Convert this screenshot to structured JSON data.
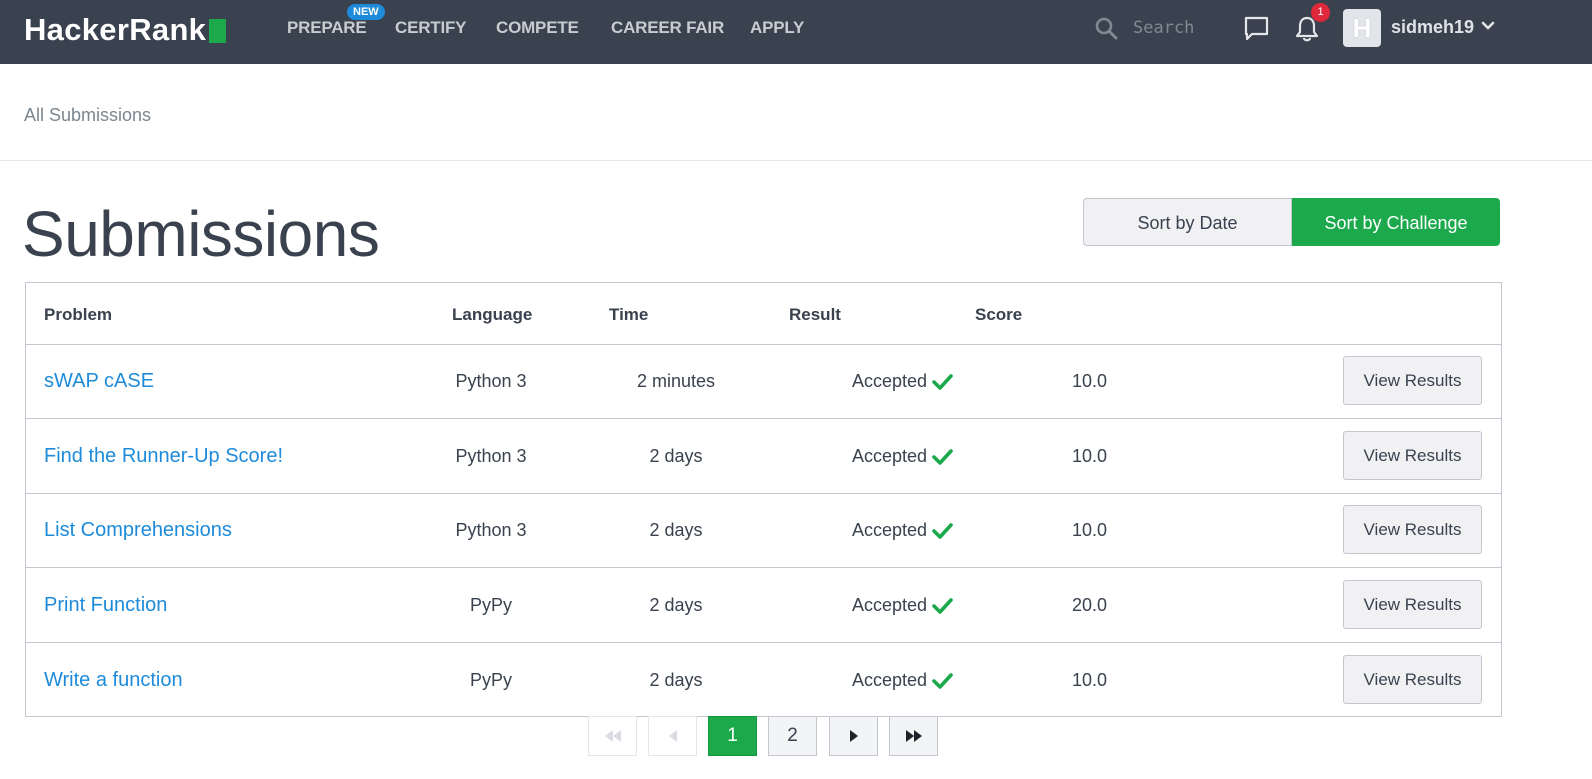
{
  "navbar": {
    "logo_text": "HackerRank",
    "items": [
      {
        "label": "PREPARE"
      },
      {
        "label": "CERTIFY"
      },
      {
        "label": "COMPETE"
      },
      {
        "label": "CAREER FAIR"
      },
      {
        "label": "APPLY"
      }
    ],
    "new_badge": "NEW",
    "search_placeholder": "Search",
    "notification_count": "1",
    "avatar_letter": "H",
    "username": "sidmeh19",
    "icons": [
      "search-icon",
      "chat-icon",
      "bell-icon",
      "chevron-down-icon"
    ]
  },
  "breadcrumb": "All Submissions",
  "page_title": "Submissions",
  "sort": {
    "date_label": "Sort by Date",
    "challenge_label": "Sort by Challenge",
    "active": "challenge"
  },
  "table": {
    "headers": {
      "problem": "Problem",
      "language": "Language",
      "time": "Time",
      "result": "Result",
      "score": "Score"
    },
    "rows": [
      {
        "problem": "sWAP cASE",
        "language": "Python 3",
        "time": "2 minutes",
        "result": "Accepted",
        "score": "10.0",
        "action": "View Results"
      },
      {
        "problem": "Find the Runner-Up Score!",
        "language": "Python 3",
        "time": "2 days",
        "result": "Accepted",
        "score": "10.0",
        "action": "View Results"
      },
      {
        "problem": "List Comprehensions",
        "language": "Python 3",
        "time": "2 days",
        "result": "Accepted",
        "score": "10.0",
        "action": "View Results"
      },
      {
        "problem": "Print Function",
        "language": "PyPy",
        "time": "2 days",
        "result": "Accepted",
        "score": "20.0",
        "action": "View Results"
      },
      {
        "problem": "Write a function",
        "language": "PyPy",
        "time": "2 days",
        "result": "Accepted",
        "score": "10.0",
        "action": "View Results"
      }
    ]
  },
  "pagination": {
    "pages": [
      "1",
      "2"
    ],
    "current": "1"
  },
  "colors": {
    "navbar_bg": "#39424e",
    "accent_green": "#1ba94c",
    "link_blue": "#1d8bda",
    "badge_red": "#e0283c"
  }
}
